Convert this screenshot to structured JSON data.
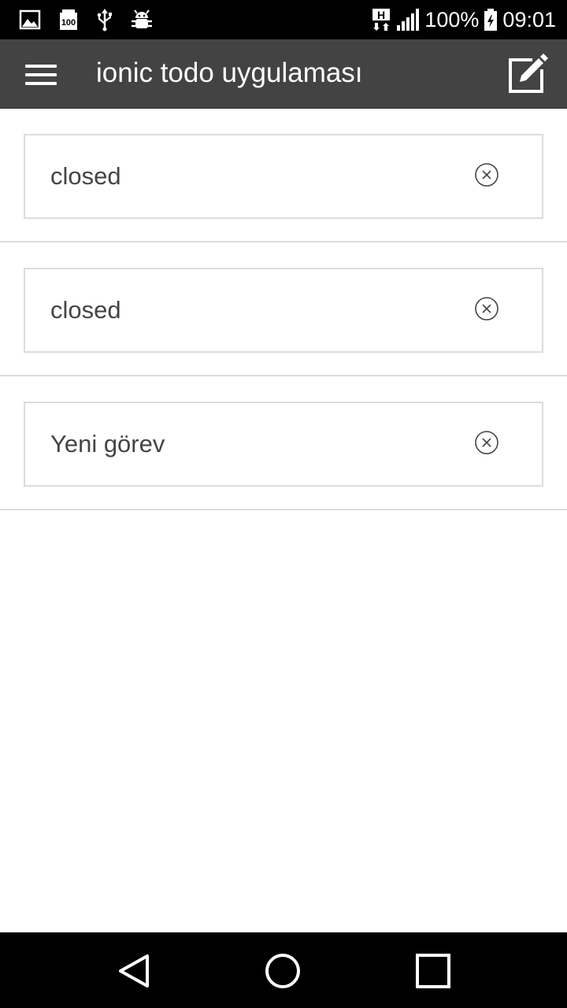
{
  "status_bar": {
    "battery_text": "100%",
    "time": "09:01",
    "network_badge": "H",
    "notification_icons": [
      "image-icon",
      "storage-100-icon",
      "usb-icon",
      "android-debug-icon"
    ],
    "system_icons": [
      "network-h-icon",
      "signal-icon",
      "battery-icon"
    ]
  },
  "header": {
    "title": "ionic todo uygulaması",
    "menu_icon": "hamburger-menu-icon",
    "compose_icon": "compose-edit-icon",
    "background_color": "#434343"
  },
  "todos": [
    {
      "text": "closed",
      "clear_icon": "close-circle-icon"
    },
    {
      "text": "closed",
      "clear_icon": "close-circle-icon"
    },
    {
      "text": "Yeni görev",
      "clear_icon": "close-circle-icon"
    }
  ],
  "nav_bar": {
    "icons": [
      "back-triangle-icon",
      "home-circle-icon",
      "recents-square-icon"
    ]
  }
}
